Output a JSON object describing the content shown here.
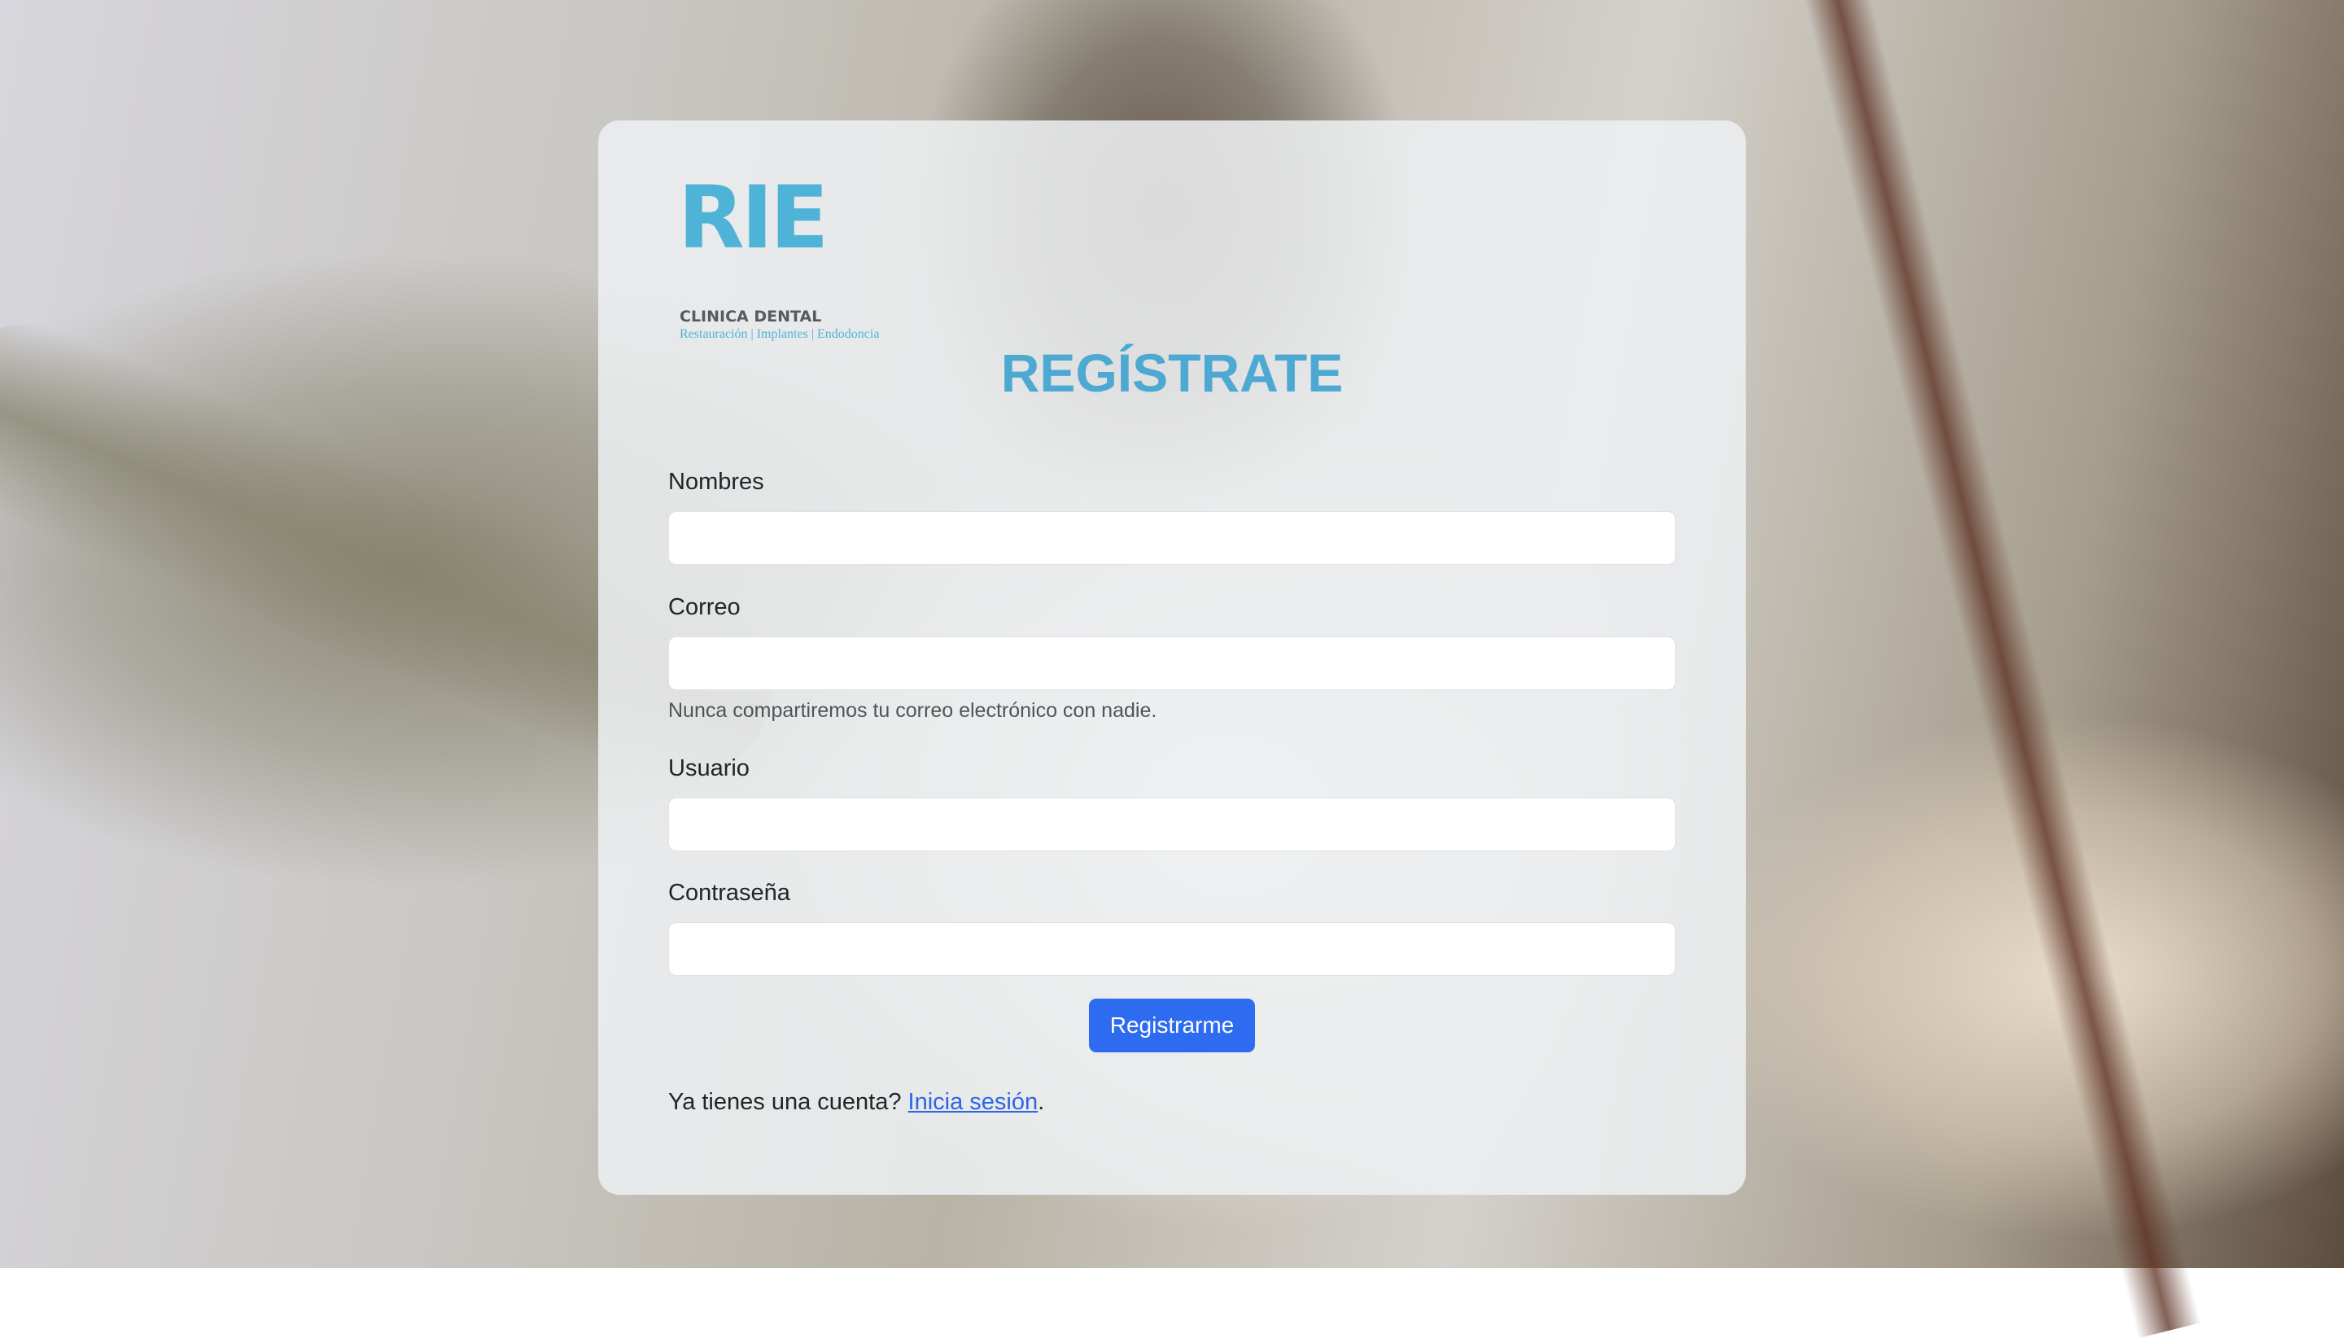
{
  "brand": {
    "logo_mark": "RIE",
    "logo_name": "CLINICA DENTAL",
    "logo_tagline": "Restauración | Implantes | Endodoncia",
    "logo_color": "#4eb3d6"
  },
  "form": {
    "title": "REGÍSTRATE",
    "title_color": "#4da9d2",
    "fields": [
      {
        "label": "Nombres",
        "value": "",
        "placeholder": ""
      },
      {
        "label": "Correo",
        "value": "",
        "placeholder": "",
        "help": "Nunca compartiremos tu correo electrónico con nadie."
      },
      {
        "label": "Usuario",
        "value": "",
        "placeholder": ""
      },
      {
        "label": "Contraseña",
        "value": "",
        "placeholder": ""
      }
    ],
    "submit_label": "Registrarme",
    "submit_color": "#2d6cf0"
  },
  "footer": {
    "prompt": "Ya tienes una cuenta? ",
    "link_label": "Inicia sesión",
    "suffix": "."
  }
}
